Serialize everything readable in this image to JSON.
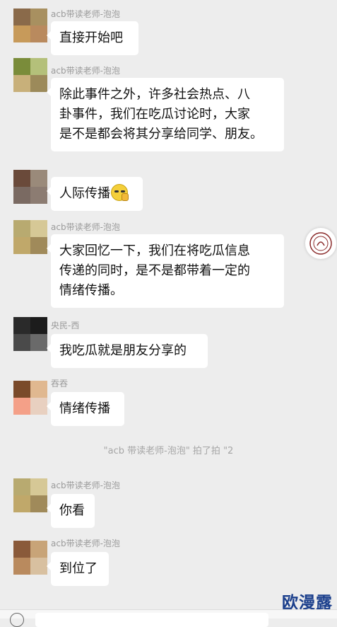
{
  "messages": [
    {
      "sender": "acb带读老师-泡泡",
      "lines": [
        "直接开始吧"
      ],
      "avatar_colors": [
        "#8a6a4a",
        "#a89060",
        "#c79a5a",
        "#b98a5e"
      ]
    },
    {
      "sender": "acb带读老师-泡泡",
      "lines": [
        "除此事件之外，许多社会热点、八",
        "卦事件，我们在吃瓜讨论时，大家",
        "是不是都会将其分享给同学、朋友。"
      ],
      "avatar_colors": [
        "#7a8c3a",
        "#b4c07a",
        "#c8b07a",
        "#9c8a5a"
      ]
    },
    {
      "sender": "",
      "lines": [
        "人际传播"
      ],
      "emoji": "thinking-emoji",
      "avatar_colors": [
        "#6a4a3a",
        "#9a8a7a",
        "#7a6a62",
        "#8c7c72"
      ]
    },
    {
      "sender": "acb带读老师-泡泡",
      "lines": [
        "大家回忆一下，我们在将吃瓜信息",
        "传递的同时，是不是都带着一定的",
        "情绪传播。"
      ],
      "avatar_colors": [
        "#b8aa70",
        "#d6c896",
        "#c0a86a",
        "#a08a5a"
      ]
    },
    {
      "sender": "央民-西",
      "lines": [
        "我吃瓜就是朋友分享的"
      ],
      "avatar_colors": [
        "#2a2a2a",
        "#1c1c1c",
        "#4a4a4a",
        "#6a6a6a"
      ]
    },
    {
      "sender": "吞吞",
      "lines": [
        "情绪传播"
      ],
      "avatar_colors": [
        "#7a4a2a",
        "#e0b890",
        "#f4a088",
        "#e8d0c0"
      ]
    },
    {
      "sender": "acb带读老师-泡泡",
      "lines": [
        "你看"
      ],
      "avatar_colors": [
        "#b8aa70",
        "#d6c896",
        "#c0a86a",
        "#a08a5a"
      ]
    },
    {
      "sender": "acb带读老师-泡泡",
      "lines": [
        "到位了"
      ],
      "avatar_colors": [
        "#8a5a3a",
        "#c8a478",
        "#b98a5e",
        "#d8c0a0"
      ]
    }
  ],
  "system_notice": "\"acb 带读老师-泡泡\" 拍了拍 \"2",
  "watermark": "欧漫露",
  "side_badge_icon": "school-seal-icon"
}
